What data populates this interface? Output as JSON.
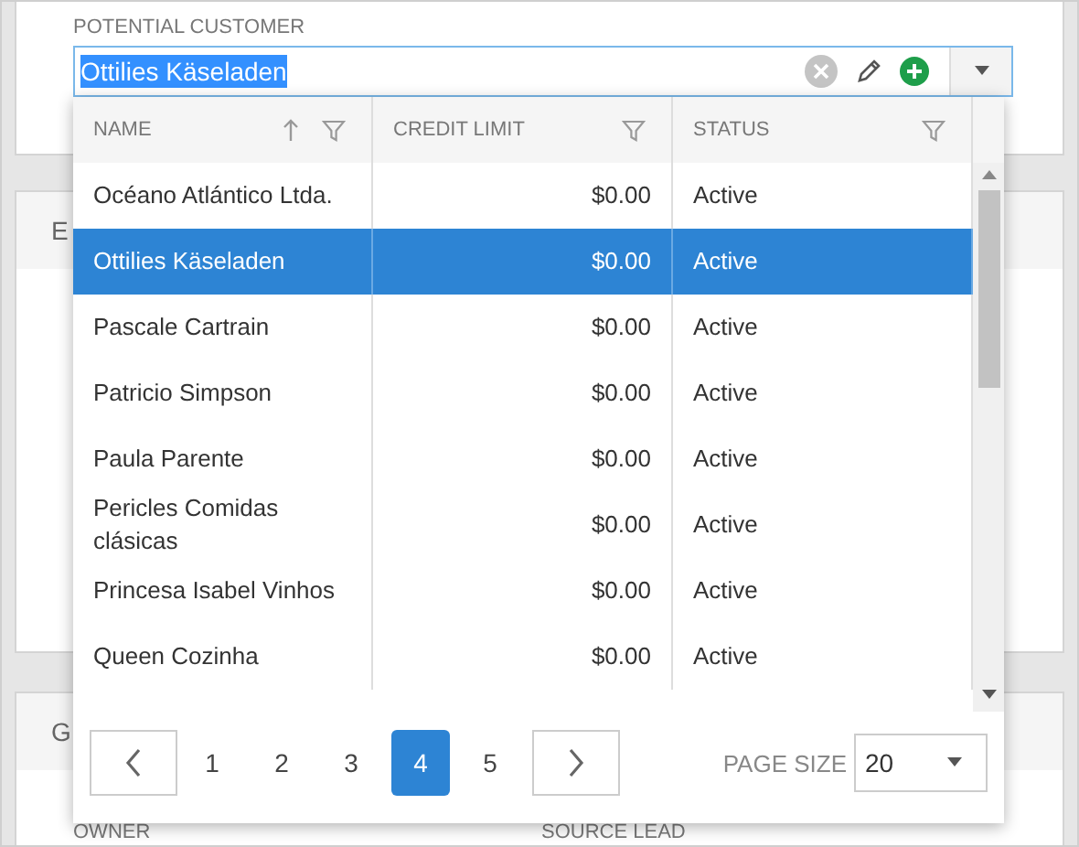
{
  "customer_field": {
    "label": "POTENTIAL CUSTOMER",
    "value": "Ottilies Käseladen",
    "text_selected": true
  },
  "panels": [
    {
      "heading": "E"
    },
    {
      "heading": "G",
      "fields": [
        "OWNER",
        "SOURCE LEAD"
      ]
    }
  ],
  "dropdown": {
    "columns": [
      {
        "label": "NAME",
        "sorted": true
      },
      {
        "label": "CREDIT LIMIT",
        "sorted": false
      },
      {
        "label": "STATUS",
        "sorted": false
      }
    ],
    "rows": [
      {
        "name": "Océano Atlántico Ltda.",
        "credit_limit": "$0.00",
        "status": "Active",
        "selected": false
      },
      {
        "name": "Ottilies Käseladen",
        "credit_limit": "$0.00",
        "status": "Active",
        "selected": true
      },
      {
        "name": "Pascale Cartrain",
        "credit_limit": "$0.00",
        "status": "Active",
        "selected": false
      },
      {
        "name": "Patricio Simpson",
        "credit_limit": "$0.00",
        "status": "Active",
        "selected": false
      },
      {
        "name": "Paula Parente",
        "credit_limit": "$0.00",
        "status": "Active",
        "selected": false
      },
      {
        "name": "Pericles Comidas clásicas",
        "credit_limit": "$0.00",
        "status": "Active",
        "selected": false
      },
      {
        "name": "Princesa Isabel Vinhos",
        "credit_limit": "$0.00",
        "status": "Active",
        "selected": false
      },
      {
        "name": "Queen Cozinha",
        "credit_limit": "$0.00",
        "status": "Active",
        "selected": false
      }
    ],
    "pager": {
      "pages": [
        {
          "label": "1",
          "selected": false
        },
        {
          "label": "2",
          "selected": false
        },
        {
          "label": "3",
          "selected": false
        },
        {
          "label": "4",
          "selected": true
        },
        {
          "label": "5",
          "selected": false
        }
      ],
      "page_size_label": "PAGE SIZE",
      "page_size": "20"
    }
  }
}
